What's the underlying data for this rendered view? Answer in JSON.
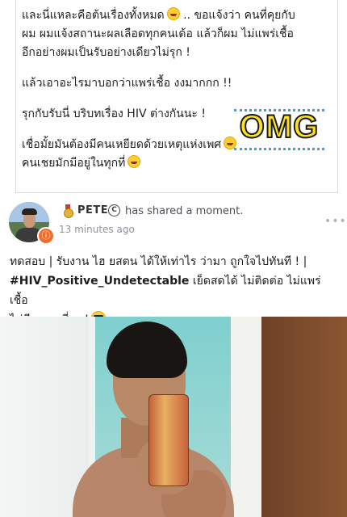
{
  "story": {
    "line1": "และนี่แหละคือต้นเรื่องทั้งหมด",
    "line1b": " .. ขอแจ้งว่า คนที่คุยกับ",
    "line2": "ผม ผมแจ้งสถานะผลเลือดทุกคนเด้อ แล้วก็ผม ไม่แพร่เชื้อ",
    "line3": "อีกอย่างผมเป็นรับอย่างเดียวไม่รุก !",
    "line4": "แล้วเอาอะไรมาบอกว่าแพร่เชื้อ งงมากกก !!",
    "line5": "รุกกับรับนี่ บริบทเรื่อง HIV ต่างกันนะ !",
    "line6": "เชื่อมั้ยมันต้องมีคนเหยียดด้วยเหตุแห่งเพศ",
    "line7": "คนเชยมักมีอยู่ในทุกที่",
    "sticker": "OMG"
  },
  "post": {
    "author": "PETE",
    "action": "has shared a moment.",
    "time": "13 minutes ago",
    "more": "•••",
    "avatar_badge": "ⓘ",
    "body_line1": "ทดสอบ | รับงาน ไฮ ยสตน ได้ให้เท่าไร ว่ามา ถูกใจไปทันที ! |",
    "hashtag": "#HIV_Positive_Undetectable",
    "body_line2_rest": " เย็ดสดได้ ไม่ติดต่อ ไม่แพร่เชื้อ",
    "body_line3": "ไม่มีความเสี่ยง !"
  },
  "icons": {
    "laugh_emoji": "laughing-face",
    "cool_emoji": "sunglasses-face",
    "medal": "medal",
    "copyright": "circle-c"
  },
  "colors": {
    "sticker_fill": "#ffe21f",
    "sticker_wave": "#2aa6e8",
    "badge": "#f26d2b",
    "muted_text": "#8d949e"
  }
}
